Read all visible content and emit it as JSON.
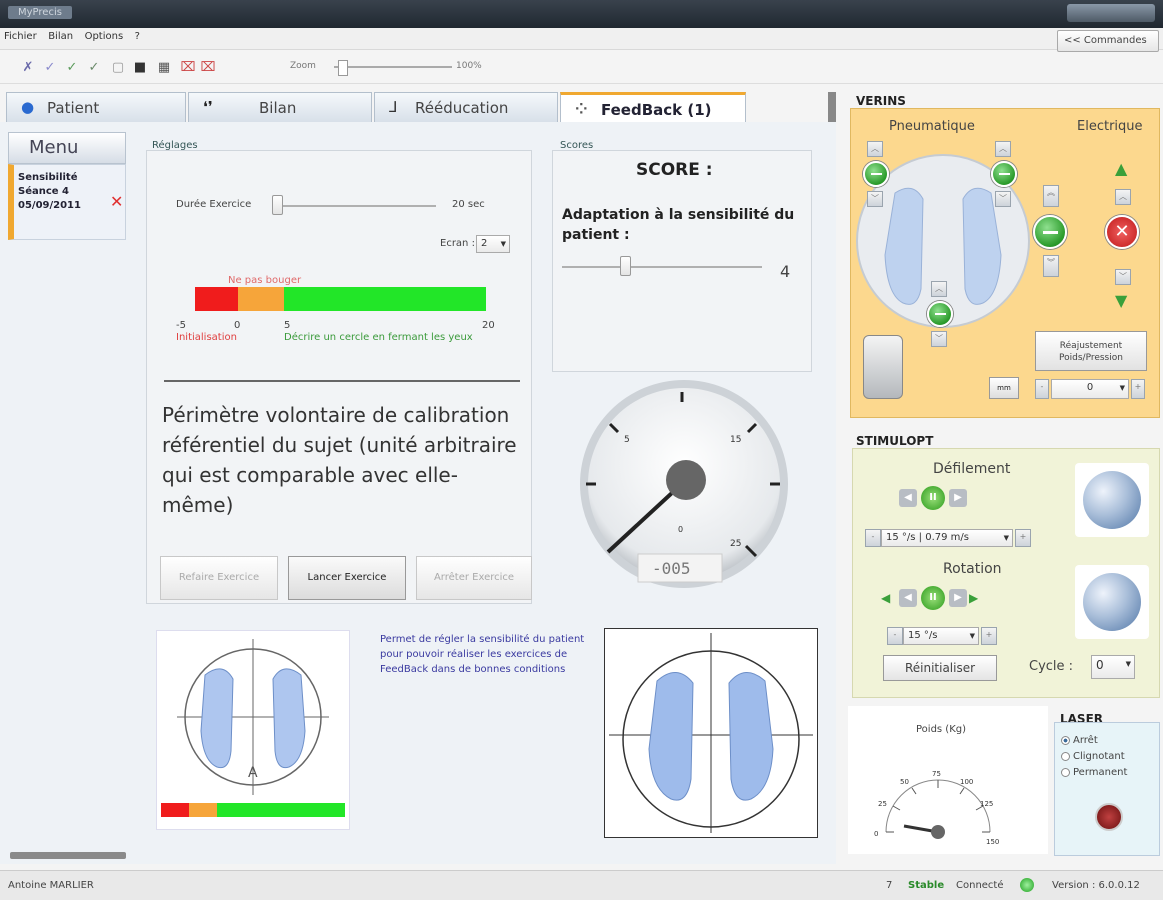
{
  "window": {
    "title": "MyPrecis"
  },
  "menubar": {
    "items": [
      "Fichier",
      "Bilan",
      "Options",
      "?"
    ],
    "commandes_label": "<< Commandes"
  },
  "toolbar": {
    "zoom_label": "Zoom",
    "zoom_value": "100%",
    "zoom_level": 1.0
  },
  "tabs": [
    {
      "label": "Patient",
      "icon": "user-icon"
    },
    {
      "label": "Bilan",
      "icon": "feet-icon"
    },
    {
      "label": "Rééducation",
      "icon": "walking-icon"
    },
    {
      "label": "FeedBack (1)",
      "icon": "feedback-icon"
    }
  ],
  "sidebar": {
    "menu_label": "Menu",
    "session": {
      "line1": "Sensibilité",
      "line2": "Séance 4",
      "line3": "05/09/2011"
    }
  },
  "reglages": {
    "title": "Réglages",
    "duree_label": "Durée Exercice",
    "duree_value": "20 sec",
    "ecran_label": "Ecran :",
    "ecran_value": "2",
    "bar_top_label": "Ne pas bouger",
    "bar_ticks": [
      "-5",
      "0",
      "5",
      "20"
    ],
    "bar_label_init": "Initialisation",
    "bar_label_desc": "Décrire un cercle en fermant les yeux",
    "big_text": "Périmètre volontaire de calibration référentiel du sujet (unité arbitraire qui est comparable avec elle-même)",
    "btn_refaire": "Refaire Exercice",
    "btn_lancer": "Lancer Exercice",
    "btn_arreter": "Arrêter Exercice"
  },
  "scores": {
    "title": "Scores",
    "score_title": "SCORE :",
    "adaptation_label": "Adaptation à la sensibilité du patient :",
    "adaptation_value": "4",
    "gauge_ticks": [
      "5",
      "15",
      "25",
      "0"
    ],
    "gauge_readout": "-005"
  },
  "foot_desc": "Permet de régler la sensibilité du patient pour pouvoir réaliser les exercices de FeedBack dans de bonnes conditions",
  "foot_left_letter": "A",
  "verins": {
    "title": "VERINS",
    "pneumatique": "Pneumatique",
    "electrique": "Electrique",
    "reajust_line1": "Réajustement",
    "reajust_line2": "Poids/Pression",
    "small_btn": "mm",
    "stepper_value": "0"
  },
  "stimulopt": {
    "title": "STIMULOPT",
    "defilement": "Défilement",
    "defil_value": "15 °/s  |  0.79 m/s",
    "rotation": "Rotation",
    "rot_value": "15 °/s",
    "reinit": "Réinitialiser",
    "cycle_label": "Cycle :",
    "cycle_value": "0"
  },
  "poids": {
    "title": "Poids (Kg)",
    "ticks": [
      "0",
      "25",
      "50",
      "75",
      "100",
      "125",
      "150"
    ]
  },
  "laser": {
    "title": "LASER",
    "options": [
      "Arrêt",
      "Clignotant",
      "Permanent"
    ],
    "selected": "Arrêt"
  },
  "status": {
    "user": "Antoine MARLIER",
    "count": "7",
    "stable": "Stable",
    "connecte": "Connecté",
    "version": "Version : 6.0.0.12"
  }
}
